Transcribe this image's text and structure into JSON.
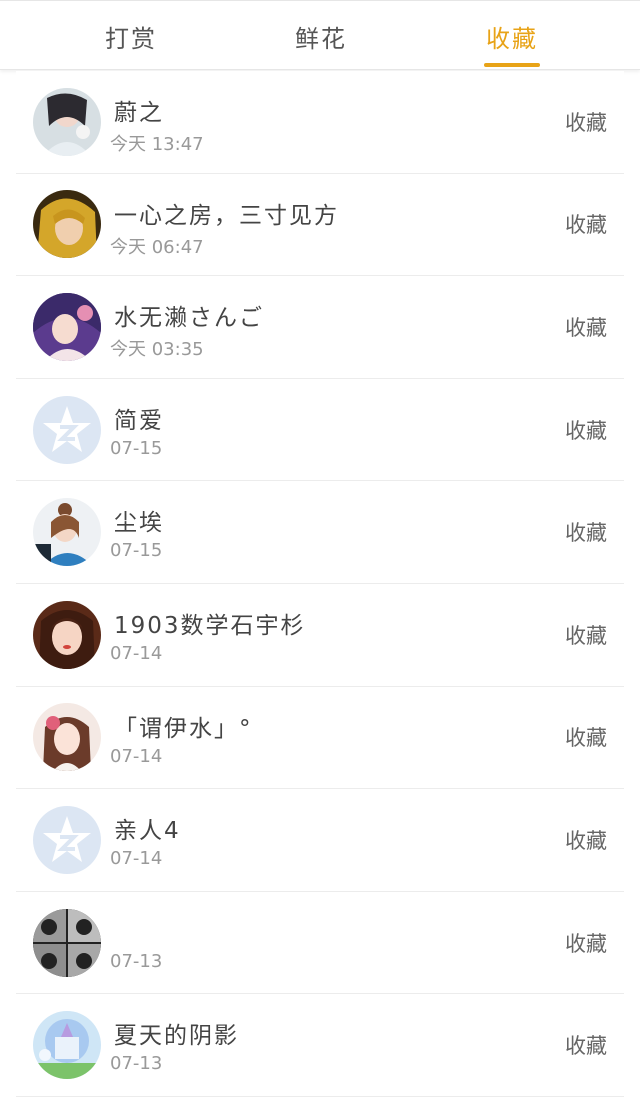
{
  "tabs": [
    {
      "label": "打赏"
    },
    {
      "label": "鲜花"
    },
    {
      "label": "收藏"
    }
  ],
  "active_tab_color": "#e8a317",
  "items": [
    {
      "name": "蔚之",
      "time": "今天 13:47",
      "action": "收藏",
      "avatar": "photo-portrait"
    },
    {
      "name": "一心之房，三寸见方",
      "time": "今天 06:47",
      "action": "收藏",
      "avatar": "photo-portrait"
    },
    {
      "name": "水无濑さんご",
      "time": "今天 03:35",
      "action": "收藏",
      "avatar": "anime-portrait"
    },
    {
      "name": "简爱",
      "time": "07-15",
      "action": "收藏",
      "avatar": "default-star-icon"
    },
    {
      "name": "尘埃",
      "time": "07-15",
      "action": "收藏",
      "avatar": "photo-portrait"
    },
    {
      "name": "1903数学石宇杉",
      "time": "07-14",
      "action": "收藏",
      "avatar": "photo-portrait"
    },
    {
      "name": "「谓伊水」°",
      "time": "07-14",
      "action": "收藏",
      "avatar": "anime-portrait"
    },
    {
      "name": "亲人4",
      "time": "07-14",
      "action": "收藏",
      "avatar": "default-star-icon"
    },
    {
      "name": "",
      "time": "07-13",
      "action": "收藏",
      "avatar": "photo-grid"
    },
    {
      "name": "夏天的阴影",
      "time": "07-13",
      "action": "收藏",
      "avatar": "castle-illustration"
    }
  ]
}
